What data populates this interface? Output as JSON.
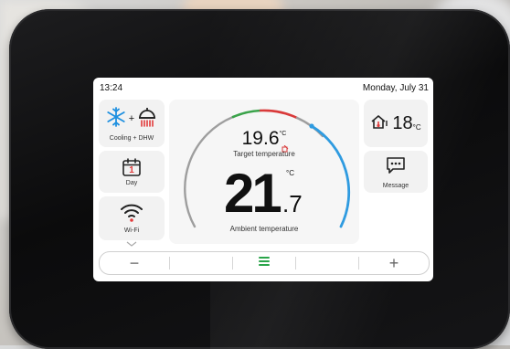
{
  "status_bar": {
    "time": "13:24",
    "date": "Monday, July 31"
  },
  "mode_card": {
    "label": "Cooling + DHW",
    "plus": "+"
  },
  "schedule_card": {
    "label": "Day",
    "day_number": "1"
  },
  "wifi_card": {
    "label": "Wi-Fi"
  },
  "outdoor_card": {
    "temperature": "18",
    "unit": "°C"
  },
  "message_card": {
    "label": "Message"
  },
  "target": {
    "value": "19.6",
    "unit": "°C",
    "label": "Target temperature"
  },
  "ambient": {
    "integer": "21",
    "decimal": ".7",
    "unit": "°C",
    "label": "Ambient temperature"
  },
  "bottom_bar": {
    "minus": "−",
    "plus": "+"
  },
  "colors": {
    "arc_gray": "#9e9e9e",
    "arc_green": "#3aa34a",
    "arc_red": "#d93a3a",
    "arc_blue": "#2f9be0",
    "menu_green": "#2aa54a",
    "snow_blue": "#1e90e0"
  }
}
